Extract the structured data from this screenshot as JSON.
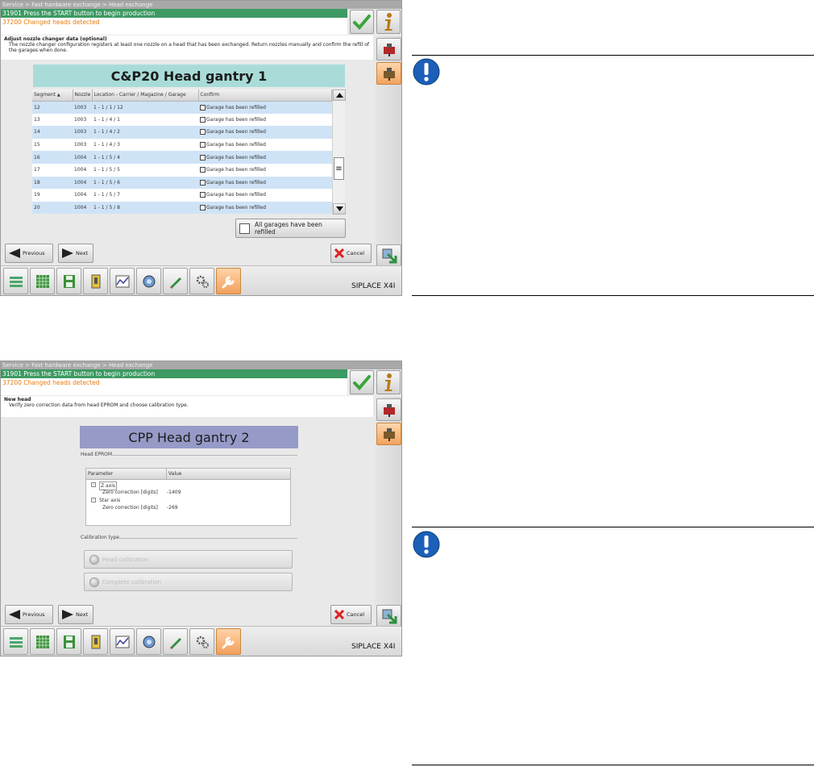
{
  "screens": [
    {
      "breadcrumb": "Service > Fast hardware exchange > Head exchange",
      "message_primary": "31901 Press the START button to begin production",
      "message_secondary": "37200 Changed heads detected",
      "instruction_title": "Adjust nozzle changer data (optional)",
      "instruction_text": "The nozzle changer configuration registers at least one nozzle on a head that has been exchanged. Return nozzles manually and confirm the refill of the garages when done.",
      "header_title": "C&P20 Head gantry 1",
      "table": {
        "columns": [
          "Segment",
          "Nozzle",
          "Location  -  Carrier / Magazine / Garage",
          "Confirm"
        ],
        "rows": [
          {
            "segment": "12",
            "nozzle": "1003",
            "location": "1  -  1 / 1 / 12",
            "confirm": "Garage has been refilled"
          },
          {
            "segment": "13",
            "nozzle": "1003",
            "location": "1  -  1 / 4 / 1",
            "confirm": "Garage has been refilled"
          },
          {
            "segment": "14",
            "nozzle": "1003",
            "location": "1  -  1 / 4 / 2",
            "confirm": "Garage has been refilled"
          },
          {
            "segment": "15",
            "nozzle": "1003",
            "location": "1  -  1 / 4 / 3",
            "confirm": "Garage has been refilled"
          },
          {
            "segment": "16",
            "nozzle": "1004",
            "location": "1  -  1 / 5 / 4",
            "confirm": "Garage has been refilled"
          },
          {
            "segment": "17",
            "nozzle": "1004",
            "location": "1  -  1 / 5 / 5",
            "confirm": "Garage has been refilled"
          },
          {
            "segment": "18",
            "nozzle": "1004",
            "location": "1  -  1 / 5 / 6",
            "confirm": "Garage has been refilled"
          },
          {
            "segment": "19",
            "nozzle": "1004",
            "location": "1  -  1 / 5 / 7",
            "confirm": "Garage has been refilled"
          },
          {
            "segment": "20",
            "nozzle": "1004",
            "location": "1  -  1 / 5 / 8",
            "confirm": "Garage has been refilled"
          }
        ]
      },
      "all_refilled_label": "All garages have been refilled",
      "previous_label": "Previous",
      "next_label": "Next",
      "cancel_label": "Cancel",
      "machine_name": "SIPLACE X4I"
    },
    {
      "breadcrumb": "Service > Fast hardware exchange > Head exchange",
      "message_primary": "31901 Press the START button to begin production",
      "message_secondary": "37200 Changed heads detected",
      "instruction_title": "New head",
      "instruction_text": "Verify zero correction data from head EPROM and choose calibration type.",
      "header_title": "CPP Head gantry 2",
      "eprom_label": "Head EPROM",
      "eprom_columns": [
        "Parameter",
        "Value"
      ],
      "eprom_rows": [
        {
          "param": "Z axis",
          "value": ""
        },
        {
          "param": "Zero correction [digits]",
          "value": "-1409"
        },
        {
          "param": "Star axis",
          "value": ""
        },
        {
          "param": "Zero correction [digits]",
          "value": "-269"
        }
      ],
      "calibration_label": "Calibration type",
      "calibration_options": [
        "Head calibration",
        "Complete calibration"
      ],
      "previous_label": "Previous",
      "next_label": "Next",
      "cancel_label": "Cancel",
      "machine_name": "SIPLACE X4I"
    }
  ],
  "colors": {
    "message_bar": "#3c9a62",
    "warning_text": "#e47b10",
    "head1_header": "#a9dcd9",
    "head2_header": "#969ac7",
    "active_button": "#f2a35d",
    "notice_blue": "#1c5fb8"
  },
  "icons": {
    "confirm": "checkmark-icon",
    "info": "info-icon",
    "notice": "exclamation-icon"
  }
}
